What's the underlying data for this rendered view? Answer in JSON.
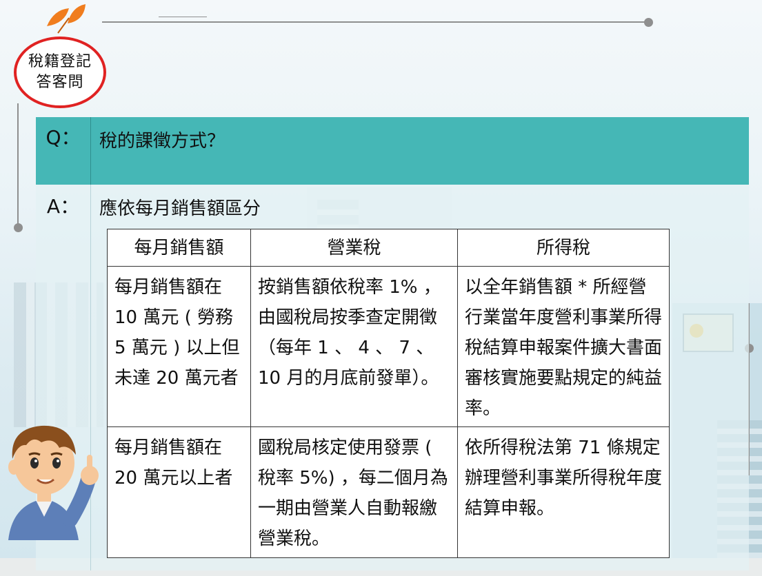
{
  "badge": {
    "line1": "稅籍登記",
    "line2": "答客問"
  },
  "question": {
    "label": "Q：",
    "text": "稅的課徵方式？"
  },
  "answer": {
    "label": "A：",
    "intro": "應依每月銷售額區分"
  },
  "table": {
    "headers": [
      "每月銷售額",
      "營業稅",
      "所得稅"
    ],
    "rows": [
      [
        "每月銷售額在 10 萬元 ( 勞務 5 萬元 ) 以上但未達 20 萬元者",
        "按銷售額依稅率 1% ，由國稅局按季查定開徵 （每年 1 、 4 、 7 、 10 月的月底前發單）。",
        "以全年銷售額 * 所經營行業當年度營利事業所得稅結算申報案件擴大書面審核實施要點規定的純益率。"
      ],
      [
        "每月銷售額在 20 萬元以上者",
        "國稅局核定使用發票 ( 稅率 5%) ，每二個月為一期由營業人自動報繳營業稅。",
        "依所得稅法第 71 條規定辦理營利事業所得稅年度結算申報。"
      ]
    ]
  },
  "colors": {
    "accent_teal": "#45b7b6",
    "badge_red": "#e02222",
    "leaf_orange": "#f07d1e"
  }
}
